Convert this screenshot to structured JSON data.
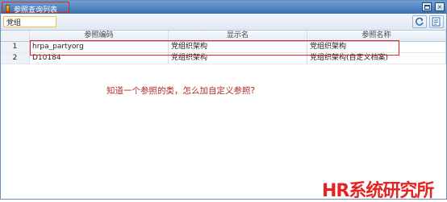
{
  "window": {
    "title": "参照查询列表",
    "restore_label": "",
    "close_label": "×"
  },
  "toolbar": {
    "search_value": "党组"
  },
  "table": {
    "headers": [
      "",
      "参照编码",
      "显示名",
      "参照名称"
    ],
    "rows": [
      {
        "index": "1",
        "code": "hrpa_partyorg",
        "display": "党组织架构",
        "name": "党组织架构"
      },
      {
        "index": "2",
        "code": "D10184",
        "display": "党组织架构",
        "name": "党组织架构(自定义档案)"
      }
    ]
  },
  "annotation": "知道一个参照的类，怎么加自定义参照?",
  "watermark": "HR系统研究所",
  "faint_mark": "",
  "colors": {
    "highlight": "#e0231f",
    "annotation": "#b0282a",
    "watermark": "#e52421",
    "titlebar": "#3a6fae"
  }
}
